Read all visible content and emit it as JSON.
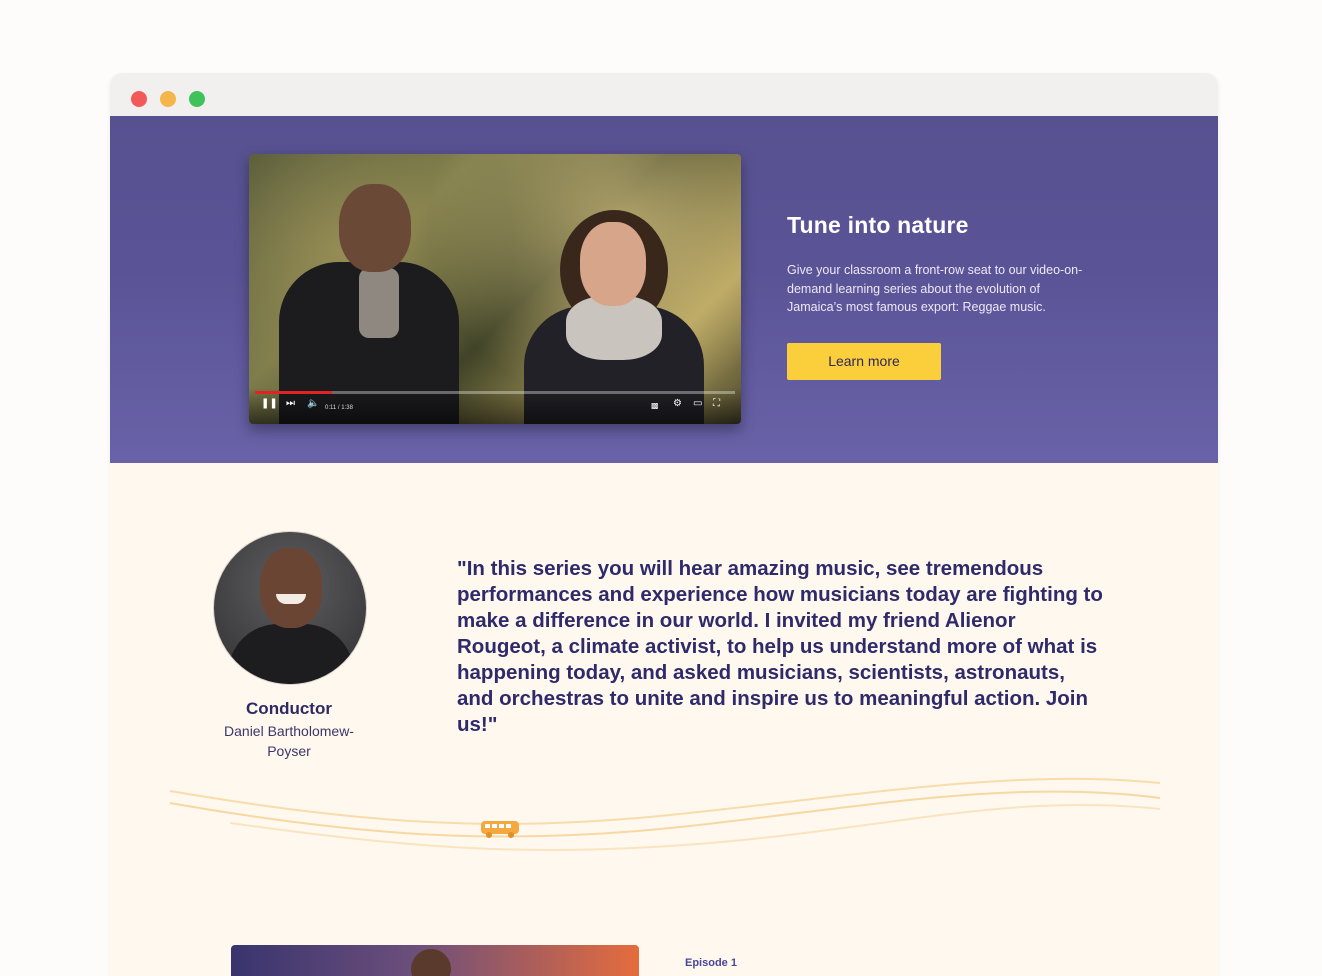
{
  "window": {
    "controls": [
      "close",
      "minimize",
      "maximize"
    ]
  },
  "hero": {
    "title": "Tune into nature",
    "description": "Give your classroom a front-row seat to our video-on-demand learning series about the evolution of Jamaica’s most famous export: Reggae music.",
    "cta_label": "Learn more",
    "video": {
      "time": "0:11 / 1:38",
      "progress_fraction": 0.16,
      "icons": [
        "pause-icon",
        "next-icon",
        "volume-icon",
        "captions-icon",
        "settings-icon",
        "theater-icon",
        "fullscreen-icon"
      ]
    }
  },
  "testimonial": {
    "role": "Conductor",
    "name": "Daniel Bartholomew-Poyser",
    "quote": "\"In this series you will hear amazing music, see tremendous performances and experience how musicians today are fighting to make a difference in our world. I invited my friend Alienor Rougeot, a climate activist, to help us understand more of what is happening today, and asked musicians, scientists, astronauts, and orchestras to unite and inspire us to meaningful action. Join us!\""
  },
  "episode": {
    "label": "Episode 1"
  },
  "colors": {
    "hero_bg": "#5a5497",
    "cta_bg": "#fbcf3c",
    "text_dark": "#2f2a6a",
    "content_bg": "#fef8ee",
    "bus": "#f5a840"
  }
}
